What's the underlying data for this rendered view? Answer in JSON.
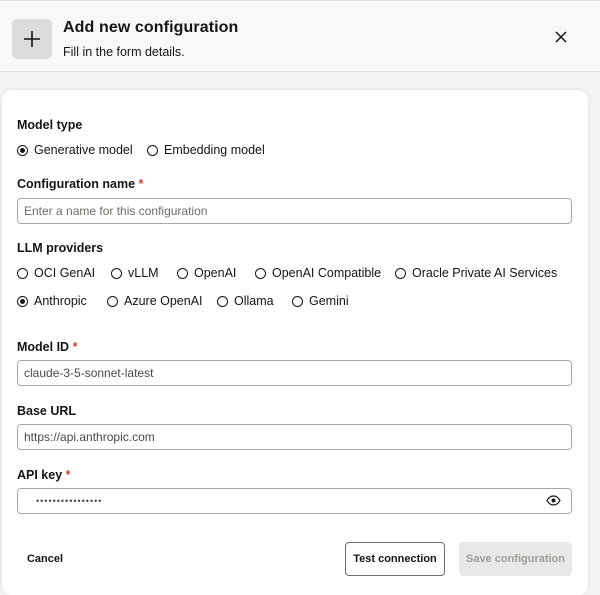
{
  "header": {
    "title": "Add new configuration",
    "subtitle": "Fill in the form details."
  },
  "model_type": {
    "label": "Model type",
    "options": [
      {
        "label": "Generative model",
        "checked": true
      },
      {
        "label": "Embedding model",
        "checked": false
      }
    ]
  },
  "config_name": {
    "label": "Configuration name",
    "required_mark": "*",
    "value": "",
    "placeholder": "Enter a name for this configuration"
  },
  "llm_providers": {
    "label": "LLM providers",
    "options": [
      {
        "label": "OCI GenAI",
        "checked": false
      },
      {
        "label": "vLLM",
        "checked": false
      },
      {
        "label": "OpenAI",
        "checked": false
      },
      {
        "label": "OpenAI Compatible",
        "checked": false
      },
      {
        "label": "Oracle Private AI Services",
        "checked": false
      },
      {
        "label": "Anthropic",
        "checked": true
      },
      {
        "label": "Azure OpenAI",
        "checked": false
      },
      {
        "label": "Ollama",
        "checked": false
      },
      {
        "label": "Gemini",
        "checked": false
      }
    ]
  },
  "model_id": {
    "label": "Model ID",
    "required_mark": "*",
    "value": "claude-3-5-sonnet-latest"
  },
  "base_url": {
    "label": "Base URL",
    "value": "https://api.anthropic.com"
  },
  "api_key": {
    "label": "API key",
    "required_mark": "*",
    "value": "••••••••••••••••"
  },
  "footer": {
    "cancel_label": "Cancel",
    "test_label": "Test connection",
    "save_label": "Save configuration"
  }
}
